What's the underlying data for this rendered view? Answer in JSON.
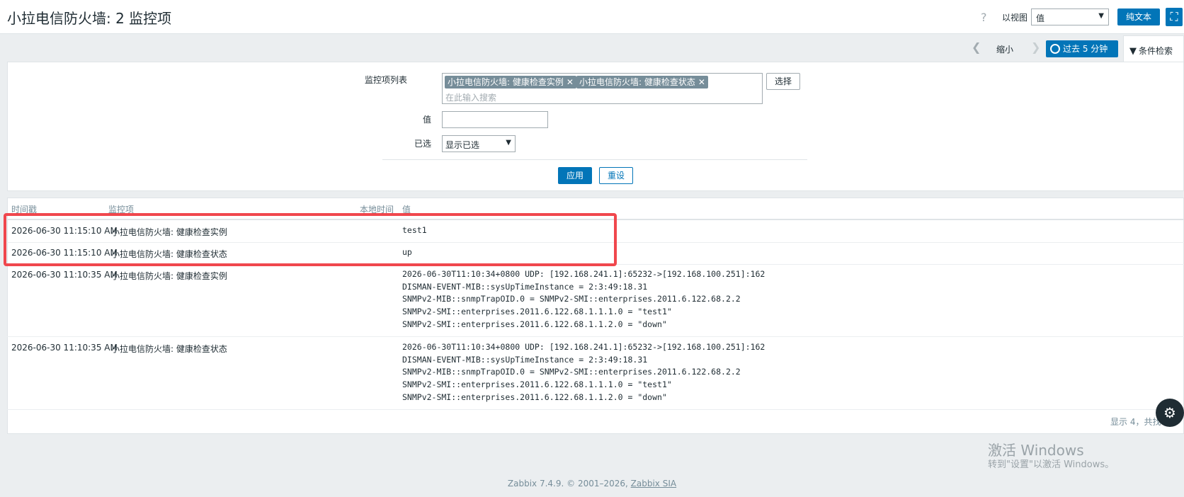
{
  "header": {
    "title": "小拉电信防火墙: 2 监控项",
    "help": "?",
    "view_label": "以视图",
    "view_value": "值",
    "plain_text_button": "纯文本"
  },
  "timebar": {
    "zoom_out": "缩小",
    "period": "过去 5 分钟",
    "filter_tab": "条件检索"
  },
  "filter": {
    "items_label": "监控项列表",
    "chips": [
      "小拉电信防火墙: 健康检查实例",
      "小拉电信防火墙: 健康检查状态"
    ],
    "search_placeholder": "在此输入搜索",
    "select_button": "选择",
    "value_label": "值",
    "value_input": "",
    "selected_label": "已选",
    "selected_value": "显示已选",
    "apply_button": "应用",
    "reset_button": "重设"
  },
  "table": {
    "headers": [
      "时间戳",
      "监控项",
      "本地时间",
      "值"
    ],
    "rows": [
      {
        "timestamp": "2026-06-30 11:15:10 AM",
        "item": "小拉电信防火墙: 健康检查实例",
        "local_time": "",
        "value": "test1"
      },
      {
        "timestamp": "2026-06-30 11:15:10 AM",
        "item": "小拉电信防火墙: 健康检查状态",
        "local_time": "",
        "value": "up"
      },
      {
        "timestamp": "2026-06-30 11:10:35 AM",
        "item": "小拉电信防火墙: 健康检查实例",
        "local_time": "",
        "value": "2026-06-30T11:10:34+0800 UDP: [192.168.241.1]:65232->[192.168.100.251]:162\nDISMAN-EVENT-MIB::sysUpTimeInstance = 2:3:49:18.31\nSNMPv2-MIB::snmpTrapOID.0 = SNMPv2-SMI::enterprises.2011.6.122.68.2.2\nSNMPv2-SMI::enterprises.2011.6.122.68.1.1.1.0 = \"test1\"\nSNMPv2-SMI::enterprises.2011.6.122.68.1.1.2.0 = \"down\""
      },
      {
        "timestamp": "2026-06-30 11:10:35 AM",
        "item": "小拉电信防火墙: 健康检查状态",
        "local_time": "",
        "value": "2026-06-30T11:10:34+0800 UDP: [192.168.241.1]:65232->[192.168.100.251]:162\nDISMAN-EVENT-MIB::sysUpTimeInstance = 2:3:49:18.31\nSNMPv2-MIB::snmpTrapOID.0 = SNMPv2-SMI::enterprises.2011.6.122.68.2.2\nSNMPv2-SMI::enterprises.2011.6.122.68.1.1.1.0 = \"test1\"\nSNMPv2-SMI::enterprises.2011.6.122.68.1.1.2.0 = \"down\""
      }
    ],
    "footer_count": "显示 4，共找"
  },
  "watermark": {
    "title": "激活 Windows",
    "subtitle": "转到\"设置\"以激活 Windows。"
  },
  "footer": {
    "copyright_prefix": "Zabbix 7.4.9. © 2001–2026, ",
    "copyright_link": "Zabbix SIA"
  },
  "colors": {
    "primary": "#0275b8",
    "highlight": "#f0474d",
    "chip": "#768d99"
  }
}
